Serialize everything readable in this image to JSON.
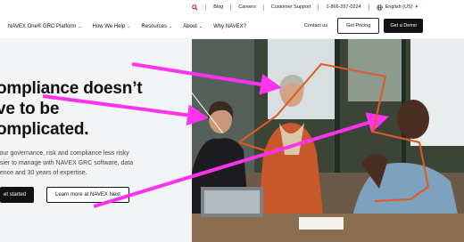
{
  "utility_bar": {
    "search_icon": "search-icon",
    "links": [
      "Blog",
      "Careers",
      "Customer Support"
    ],
    "phone": "1-866-297-0224",
    "language": "English (US)"
  },
  "nav": {
    "brand_menu": "NAVEX One® GRC Platform",
    "items": [
      "How We Help",
      "Resources",
      "About"
    ],
    "why": "Why NAVEX?",
    "contact": "Contact us",
    "pricing": "Get Pricing",
    "demo": "Get a Demo"
  },
  "hero": {
    "headline_lines": [
      "ompliance doesn’t",
      "ve to be",
      "omplicated."
    ],
    "subcopy_lines": [
      "your governance, risk and compliance less risky",
      "asier to manage with NAVEX GRC software, data",
      "gence and 30 years of expertise."
    ],
    "cta_primary": "et started",
    "cta_secondary": "Learn more at NAVEX Next"
  },
  "colors": {
    "accent_red": "#cc1f1a",
    "annotation_magenta": "#ff33ee"
  }
}
